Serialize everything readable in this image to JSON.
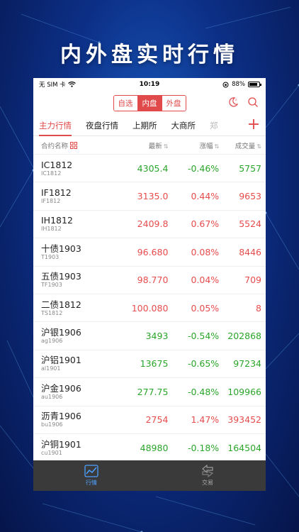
{
  "banner": {
    "title": "内外盘实时行情"
  },
  "status": {
    "carrier": "无 SIM 卡",
    "time": "10:19",
    "battery": "88%",
    "battery_level": 0.88
  },
  "nav": {
    "segments": [
      {
        "label": "自选",
        "active": false
      },
      {
        "label": "内盘",
        "active": true
      },
      {
        "label": "外盘",
        "active": false
      }
    ],
    "icons": [
      "night-mode-icon",
      "search-icon"
    ]
  },
  "tabs": [
    {
      "label": "主力行情",
      "active": true
    },
    {
      "label": "夜盘行情",
      "active": false
    },
    {
      "label": "上期所",
      "active": false
    },
    {
      "label": "大商所",
      "active": false
    },
    {
      "label": "郑",
      "active": false
    }
  ],
  "add_label": "+",
  "columns": {
    "name": "合约名称",
    "price": "最新",
    "change": "涨幅",
    "volume": "成交量"
  },
  "rows": [
    {
      "name": "IC1812",
      "code": "IC1812",
      "price": "4305.4",
      "change": "-0.46%",
      "volume": "5757",
      "trend": "down"
    },
    {
      "name": "IF1812",
      "code": "IF1812",
      "price": "3135.0",
      "change": "0.44%",
      "volume": "9653",
      "trend": "up"
    },
    {
      "name": "IH1812",
      "code": "IH1812",
      "price": "2409.8",
      "change": "0.67%",
      "volume": "5524",
      "trend": "up"
    },
    {
      "name": "十债1903",
      "code": "T1903",
      "price": "96.680",
      "change": "0.08%",
      "volume": "8446",
      "trend": "up"
    },
    {
      "name": "五债1903",
      "code": "TF1903",
      "price": "98.770",
      "change": "0.04%",
      "volume": "709",
      "trend": "up"
    },
    {
      "name": "二债1812",
      "code": "TS1812",
      "price": "100.080",
      "change": "0.05%",
      "volume": "8",
      "trend": "up"
    },
    {
      "name": "沪银1906",
      "code": "ag1906",
      "price": "3493",
      "change": "-0.54%",
      "volume": "202868",
      "trend": "down"
    },
    {
      "name": "沪铝1901",
      "code": "al1901",
      "price": "13675",
      "change": "-0.65%",
      "volume": "97234",
      "trend": "down"
    },
    {
      "name": "沪金1906",
      "code": "au1906",
      "price": "277.75",
      "change": "-0.48%",
      "volume": "109966",
      "trend": "down"
    },
    {
      "name": "沥青1906",
      "code": "bu1906",
      "price": "2754",
      "change": "1.47%",
      "volume": "393452",
      "trend": "up"
    },
    {
      "name": "沪铜1901",
      "code": "cu1901",
      "price": "48980",
      "change": "-0.18%",
      "volume": "164504",
      "trend": "down"
    }
  ],
  "bottom_nav": [
    {
      "label": "行情",
      "icon": "chart-icon",
      "active": true
    },
    {
      "label": "交易",
      "icon": "trade-icon",
      "active": false
    }
  ],
  "colors": {
    "up": "#e74c4c",
    "down": "#2aa52a",
    "accent": "#e04a4a",
    "tab_active": "#4ea0ff"
  }
}
